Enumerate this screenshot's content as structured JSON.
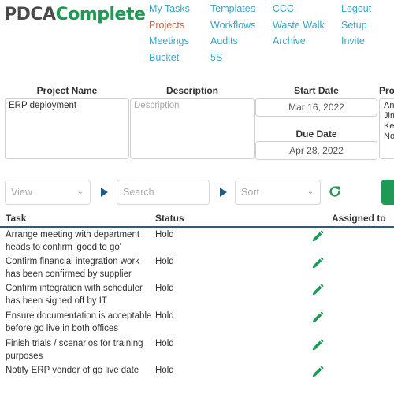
{
  "app": {
    "logo_part1": "PDCA",
    "logo_part2": "Complete"
  },
  "nav": {
    "items": [
      {
        "label": "My Tasks"
      },
      {
        "label": "Projects",
        "active": true
      },
      {
        "label": "Meetings"
      },
      {
        "label": "Bucket"
      },
      {
        "label": "Templates"
      },
      {
        "label": "Workflows"
      },
      {
        "label": "Audits"
      },
      {
        "label": "5S"
      },
      {
        "label": "CCC"
      },
      {
        "label": "Waste Walk"
      },
      {
        "label": "Archive"
      },
      {
        "label": "Logout"
      },
      {
        "label": "Setup"
      },
      {
        "label": "Invite"
      }
    ]
  },
  "project": {
    "name_label": "Project Name",
    "name_value": "ERP deployment",
    "description_label": "Description",
    "description_placeholder": "Description",
    "start_label": "Start Date",
    "start_value": "Mar 16, 2022",
    "due_label": "Due Date",
    "due_value": "Apr 28, 2022",
    "owners_label": "Proj",
    "owners": [
      "Ang",
      "Jim",
      "Ker",
      "Nor"
    ]
  },
  "controls": {
    "view_placeholder": "View",
    "search_placeholder": "Search",
    "sort_placeholder": "Sort"
  },
  "table": {
    "headers": {
      "task": "Task",
      "status": "Status",
      "assigned": "Assigned to"
    },
    "rows": [
      {
        "task": "Arrange meeting with department heads to confirm 'good to go'",
        "status": "Hold"
      },
      {
        "task": "Confirm financial integration work has been confirmed by supplier",
        "status": "Hold"
      },
      {
        "task": "Confirm integration with scheduler has been signed off by IT",
        "status": "Hold"
      },
      {
        "task": "Ensure documentation is acceptable before go live in both offices",
        "status": "Hold"
      },
      {
        "task": "Finish trials / scenarios for training purposes",
        "status": "Hold"
      },
      {
        "task": "Notify ERP vendor of go live date",
        "status": "Hold"
      }
    ]
  },
  "colors": {
    "brand_green": "#1e9a55",
    "nav_link": "#3aa6c3",
    "nav_active": "#c9623e",
    "header_rule": "#2d5b80"
  }
}
